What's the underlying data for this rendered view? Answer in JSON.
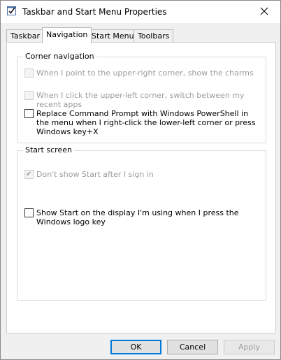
{
  "window": {
    "title": "Taskbar and Start Menu Properties",
    "app_icon": "checklist-icon",
    "close_icon": "close-icon"
  },
  "tabs": [
    {
      "label": "Taskbar",
      "active": false
    },
    {
      "label": "Navigation",
      "active": true
    },
    {
      "label": "Start Menu",
      "active": false
    },
    {
      "label": "Toolbars",
      "active": false
    }
  ],
  "corner_navigation": {
    "title": "Corner navigation",
    "options": [
      {
        "label": "When I point to the upper-right corner, show the charms",
        "checked": false,
        "enabled": false
      },
      {
        "label": "When I click the upper-left corner, switch between my recent apps",
        "checked": false,
        "enabled": false
      },
      {
        "label": "Replace Command Prompt with Windows PowerShell in the menu when I right-click the lower-left corner or press Windows key+X",
        "checked": false,
        "enabled": true
      }
    ]
  },
  "start_screen": {
    "title": "Start screen",
    "options": [
      {
        "label": "Don't show Start after I sign in",
        "checked": true,
        "enabled": false
      },
      {
        "label": "Show Start on the display I'm using when I press the Windows logo key",
        "checked": false,
        "enabled": true
      }
    ]
  },
  "buttons": {
    "ok": "OK",
    "cancel": "Cancel",
    "apply": "Apply"
  },
  "colors": {
    "accent": "#0078d7",
    "disabled_text": "#9c9c9c"
  }
}
